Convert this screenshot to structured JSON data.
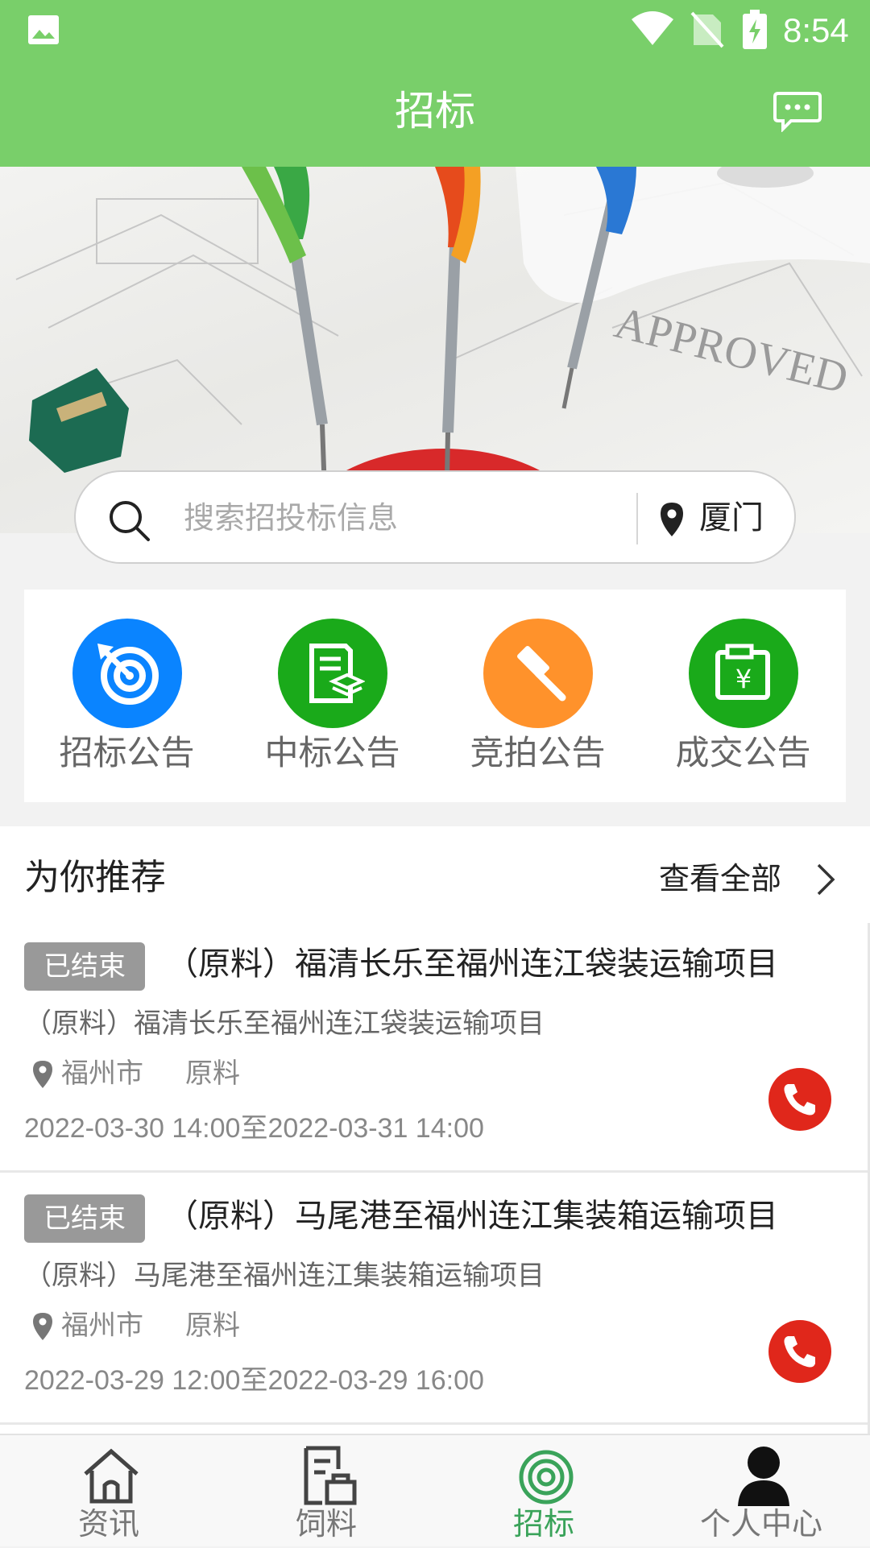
{
  "status_bar": {
    "time": "8:54",
    "icons": [
      "image-icon",
      "wifi-icon",
      "no-sim-icon",
      "battery-charging-icon"
    ]
  },
  "header": {
    "title": "招标",
    "right_icon": "message-icon"
  },
  "search": {
    "placeholder": "搜索招投标信息",
    "city": "厦门"
  },
  "categories": [
    {
      "label": "招标公告",
      "icon": "target-icon",
      "color": "#0a84ff"
    },
    {
      "label": "中标公告",
      "icon": "document-layers-icon",
      "color": "#1aaa1a"
    },
    {
      "label": "竞拍公告",
      "icon": "gavel-icon",
      "color": "#ff922b"
    },
    {
      "label": "成交公告",
      "icon": "yuan-document-icon",
      "color": "#1aaa1a"
    }
  ],
  "recommend": {
    "title": "为你推荐",
    "view_all": "查看全部",
    "items": [
      {
        "badge": "已结束",
        "title": "（原料）福清长乐至福州连江袋装运输项目",
        "subtitle": "（原料）福清长乐至福州连江袋装运输项目",
        "city": "福州市",
        "category": "原料",
        "date": "2022-03-30 14:00至2022-03-31 14:00"
      },
      {
        "badge": "已结束",
        "title": "（原料）马尾港至福州连江集装箱运输项目",
        "subtitle": "（原料）马尾港至福州连江集装箱运输项目",
        "city": "福州市",
        "category": "原料",
        "date": "2022-03-29 12:00至2022-03-29 16:00"
      }
    ]
  },
  "bottom_nav": [
    {
      "label": "资讯",
      "icon": "home-icon",
      "active": false
    },
    {
      "label": "饲料",
      "icon": "feed-doc-icon",
      "active": false
    },
    {
      "label": "招标",
      "icon": "target-icon",
      "active": true
    },
    {
      "label": "个人中心",
      "icon": "person-icon",
      "active": false
    }
  ],
  "colors": {
    "header_green": "#79cf6a",
    "active_green": "#3aa35a",
    "phone_red": "#e0271b",
    "badge_gray": "#999999"
  }
}
